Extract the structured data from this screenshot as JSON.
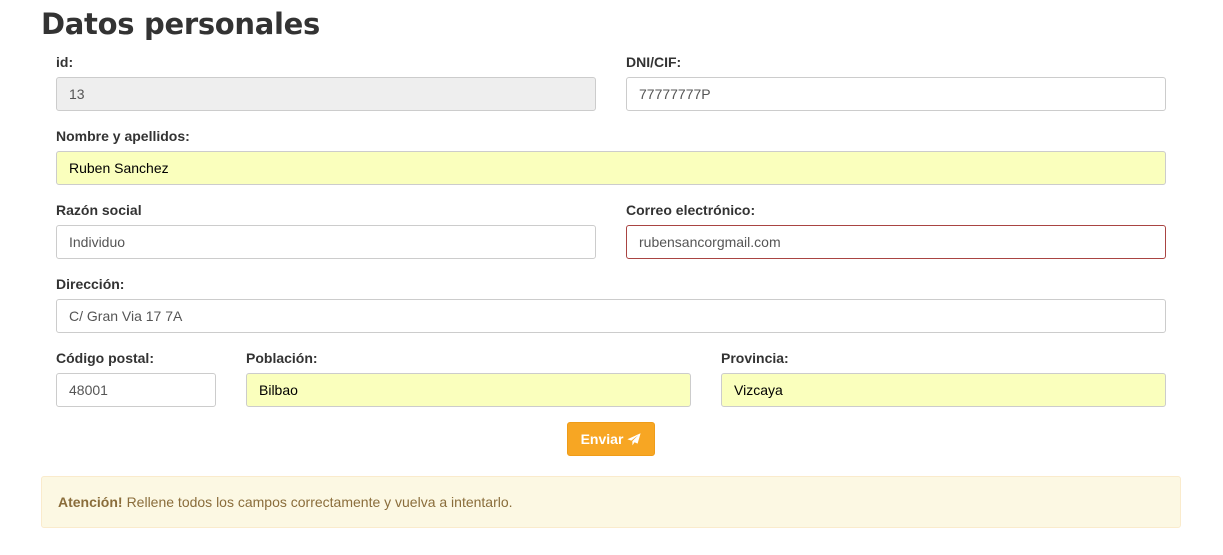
{
  "page": {
    "title": "Datos personales"
  },
  "form": {
    "id": {
      "label": "id:",
      "value": "13"
    },
    "dni": {
      "label": "DNI/CIF:",
      "value": "77777777P"
    },
    "nombre": {
      "label": "Nombre y apellidos:",
      "value": "Ruben Sanchez"
    },
    "razon_social": {
      "label": "Razón social",
      "value": "Individuo"
    },
    "correo": {
      "label": "Correo electrónico:",
      "value": "rubensancorgmail.com"
    },
    "direccion": {
      "label": "Dirección:",
      "value": "C/ Gran Via 17 7A"
    },
    "codigo_postal": {
      "label": "Código postal:",
      "value": "48001"
    },
    "poblacion": {
      "label": "Población:",
      "value": "Bilbao"
    },
    "provincia": {
      "label": "Provincia:",
      "value": "Vizcaya"
    },
    "submit_label": "Enviar",
    "submit_icon": "paper-plane-icon"
  },
  "alert": {
    "strong": "Atención!",
    "message": "Rellene todos los campos correctamente y vuelva a intentarlo."
  },
  "colors": {
    "accent_button": "#f7a623",
    "autofill_background": "#faffbd",
    "invalid_border": "#a94442",
    "alert_background": "#fcf8e3",
    "alert_text": "#8a6d3b",
    "readonly_background": "#eeeeee"
  }
}
